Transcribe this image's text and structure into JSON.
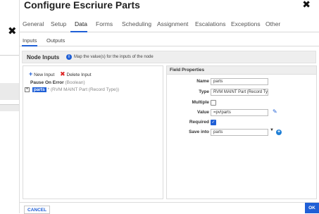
{
  "dialog": {
    "title": "Configure Escriure Parts"
  },
  "tabs": [
    "General",
    "Setup",
    "Data",
    "Forms",
    "Scheduling",
    "Assignment",
    "Escalations",
    "Exceptions",
    "Other"
  ],
  "subtabs": [
    "Inputs",
    "Outputs"
  ],
  "node_inputs": {
    "label": "Node Inputs",
    "hint": "Map the value(s) for the inputs of the node"
  },
  "toolbar": {
    "new_label": "New Input",
    "delete_label": "Delete Input"
  },
  "tree": [
    {
      "name": "Pause On Error",
      "type": "(Boolean)"
    },
    {
      "name": "parts",
      "type": "(RVM MAINT Part (Record Type))",
      "selected": true
    }
  ],
  "field_properties": {
    "header": "Field Properties",
    "name_label": "Name",
    "name_value": "parts",
    "type_label": "Type",
    "type_value": "RVM MAINT Part (Record Type)",
    "multiple_label": "Multiple",
    "multiple_checked": false,
    "value_label": "Value",
    "value_value": "=pv!parts",
    "required_label": "Required",
    "required_checked": true,
    "save_label": "Save into",
    "save_value": "parts"
  },
  "footer": {
    "cancel_label": "CANCEL",
    "ok_label": "OK"
  },
  "colors": {
    "accent": "#1f5fd6",
    "delete": "#dd2222"
  }
}
